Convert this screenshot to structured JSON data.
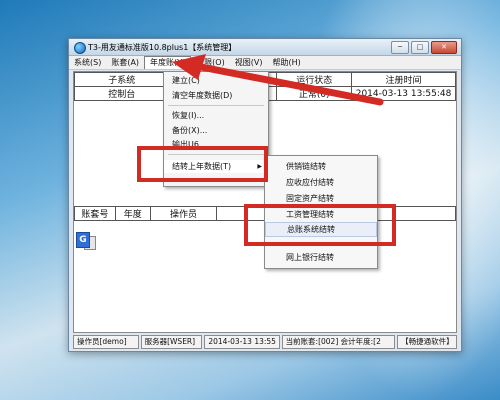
{
  "window": {
    "title": "T3-用友通标准版10.8plus1【系统管理】",
    "buttons": [
      "─",
      "□",
      "✕"
    ]
  },
  "menubar": {
    "items": [
      "系统(S)",
      "账套(A)",
      "年度账(Y)",
      "权限(O)",
      "视图(V)",
      "帮助(H)"
    ]
  },
  "top_table": {
    "headers": [
      "子系统",
      "",
      "运行状态",
      "注册时间"
    ],
    "row": [
      "控制台",
      "",
      "正常(0)",
      "2014-03-13 13:55:48"
    ]
  },
  "bottom_table": {
    "headers": [
      "账套号",
      "年度",
      "操作员",
      ""
    ]
  },
  "year_menu": {
    "items": [
      "建立(C)",
      "清空年度数据(D)",
      "恢复(I)...",
      "备份(X)...",
      "输出U6",
      "结转上年数据(T)"
    ]
  },
  "carryover_submenu": {
    "items": [
      "供销链结转",
      "应收应付结转",
      "固定资产结转",
      "工资管理结转",
      "总账系统结转",
      "",
      "网上银行结转"
    ]
  },
  "statusbar": {
    "operator": "操作员[demo]",
    "server": "服务器[WSER]",
    "datetime": "2014-03-13  13:55",
    "account": "当前账套:[002] 会计年度:[2",
    "brand": "【畅捷通软件】"
  },
  "colors": {
    "annotation_red": "#d42a24",
    "title_bar": "#c5d7e8",
    "desktop": "#6fb3df"
  }
}
